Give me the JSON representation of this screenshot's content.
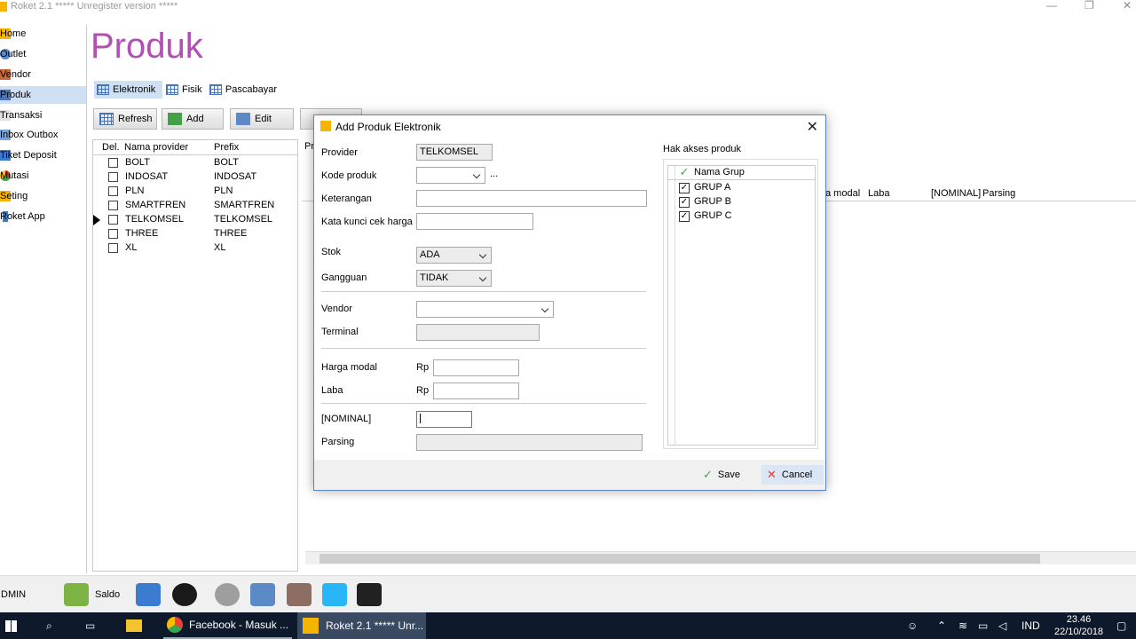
{
  "window": {
    "title": "Roket 2.1 ***** Unregister version *****"
  },
  "sidebar": {
    "items": [
      {
        "label": "Home"
      },
      {
        "label": "Outlet"
      },
      {
        "label": "Vendor"
      },
      {
        "label": "Produk"
      },
      {
        "label": "Transaksi"
      },
      {
        "label": "Inbox Outbox"
      },
      {
        "label": "Tiket Deposit"
      },
      {
        "label": "Mutasi"
      },
      {
        "label": "Seting"
      },
      {
        "label": "Roket App"
      }
    ]
  },
  "page": {
    "title": "Produk"
  },
  "tabs": [
    {
      "label": "Elektronik"
    },
    {
      "label": "Fisik"
    },
    {
      "label": "Pascabayar"
    }
  ],
  "toolbar": {
    "refresh": "Refresh",
    "add": "Add",
    "edit": "Edit"
  },
  "provider_grid": {
    "headers": {
      "del": "Del.",
      "name": "Nama provider",
      "prefix": "Prefix"
    },
    "rows": [
      {
        "name": "BOLT",
        "prefix": "BOLT"
      },
      {
        "name": "INDOSAT",
        "prefix": "INDOSAT"
      },
      {
        "name": "PLN",
        "prefix": "PLN"
      },
      {
        "name": "SMARTFREN",
        "prefix": "SMARTFREN"
      },
      {
        "name": "TELKOMSEL",
        "prefix": "TELKOMSEL"
      },
      {
        "name": "THREE",
        "prefix": "THREE"
      },
      {
        "name": "XL",
        "prefix": "XL"
      }
    ]
  },
  "product_grid": {
    "headers": {
      "modal": "a modal",
      "laba": "Laba",
      "nominal": "[NOMINAL]",
      "parsing": "Parsing",
      "pr": "Pr"
    }
  },
  "dialog": {
    "title": "Add Produk Elektronik",
    "labels": {
      "provider": "Provider",
      "kode": "Kode produk",
      "keterangan": "Keterangan",
      "kata_kunci": "Kata kunci cek harga",
      "stok": "Stok",
      "gangguan": "Gangguan",
      "vendor": "Vendor",
      "terminal": "Terminal",
      "harga_modal": "Harga modal",
      "laba": "Laba",
      "nominal": "[NOMINAL]",
      "parsing": "Parsing",
      "rp": "Rp",
      "ellipsis": "..."
    },
    "values": {
      "provider": "TELKOMSEL",
      "stok": "ADA",
      "gangguan": "TIDAK"
    },
    "access": {
      "title": "Hak akses produk",
      "header": "Nama Grup",
      "groups": [
        {
          "name": "GRUP A",
          "checked": true
        },
        {
          "name": "GRUP B",
          "checked": true
        },
        {
          "name": "GRUP C",
          "checked": true
        }
      ]
    },
    "buttons": {
      "save": "Save",
      "cancel": "Cancel"
    }
  },
  "bottombar": {
    "user": "DMIN",
    "saldo": "Saldo"
  },
  "taskbar": {
    "facebook": "Facebook - Masuk ...",
    "roket": "Roket 2.1 ***** Unr...",
    "lang": "IND",
    "time": "23.46",
    "date": "22/10/2018"
  }
}
